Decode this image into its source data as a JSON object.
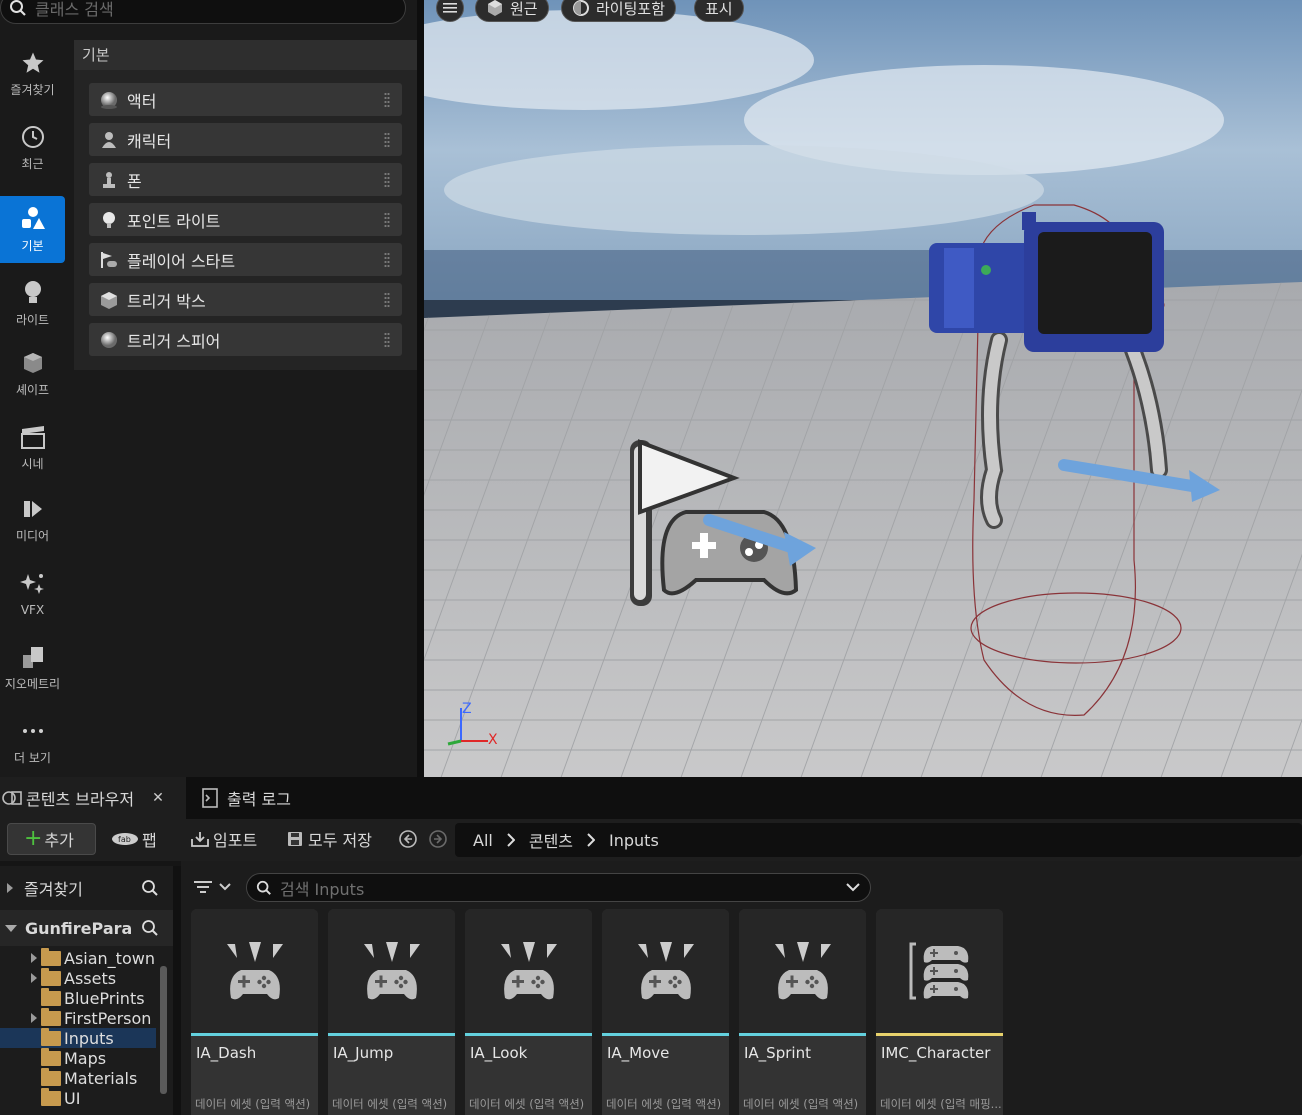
{
  "class_search": {
    "placeholder": "클래스 검색"
  },
  "categories": [
    {
      "label": "즐겨찾기",
      "icon": "star-icon"
    },
    {
      "label": "최근",
      "icon": "clock-icon"
    },
    {
      "label": "기본",
      "icon": "basic-shapes-icon",
      "active": true
    },
    {
      "label": "라이트",
      "icon": "lightbulb-icon"
    },
    {
      "label": "셰이프",
      "icon": "cube-icon"
    },
    {
      "label": "시네",
      "icon": "clapperboard-icon"
    },
    {
      "label": "미디어",
      "icon": "media-icon"
    },
    {
      "label": "VFX",
      "icon": "sparkles-icon"
    },
    {
      "label": "지오메트리",
      "icon": "geometry-icon"
    },
    {
      "label": "더 보기",
      "icon": "more-dots-icon"
    }
  ],
  "section": {
    "title": "기본"
  },
  "place_items": [
    {
      "label": "액터",
      "icon": "actor-sphere-icon"
    },
    {
      "label": "캐릭터",
      "icon": "character-icon"
    },
    {
      "label": "폰",
      "icon": "pawn-icon"
    },
    {
      "label": "포인트 라이트",
      "icon": "point-light-icon"
    },
    {
      "label": "플레이어 스타트",
      "icon": "player-start-icon"
    },
    {
      "label": "트리거 박스",
      "icon": "trigger-box-icon"
    },
    {
      "label": "트리거 스피어",
      "icon": "trigger-sphere-icon"
    }
  ],
  "viewport": {
    "menu_icon": "hamburger-icon",
    "perspective_label": "원근",
    "lighting_label": "라이팅포함",
    "show_label": "표시",
    "axis_z": "Z",
    "axis_x": "X"
  },
  "content_browser": {
    "tab_label": "콘텐츠 브라우저",
    "output_log_label": "출력 로그",
    "add_label": "추가",
    "fab_label": "팹",
    "import_label": "임포트",
    "save_all_label": "모두 저장",
    "breadcrumb": [
      "All",
      "콘텐츠",
      "Inputs"
    ],
    "favorites_label": "즐겨찾기",
    "project_label": "GunfireParagon",
    "search_placeholder": "검색 Inputs",
    "folders": [
      {
        "name": "Asian_town",
        "expandable": true
      },
      {
        "name": "Assets",
        "expandable": true
      },
      {
        "name": "BluePrints",
        "expandable": false
      },
      {
        "name": "FirstPerson",
        "expandable": true
      },
      {
        "name": "Inputs",
        "expandable": false,
        "selected": true
      },
      {
        "name": "Maps",
        "expandable": false
      },
      {
        "name": "Materials",
        "expandable": false
      },
      {
        "name": "UI",
        "expandable": false
      }
    ],
    "assets": [
      {
        "name": "IA_Dash",
        "type": "데이터 에셋 (입력 액션)"
      },
      {
        "name": "IA_Jump",
        "type": "데이터 에셋 (입력 액션)"
      },
      {
        "name": "IA_Look",
        "type": "데이터 에셋 (입력 액션)"
      },
      {
        "name": "IA_Move",
        "type": "데이터 에셋 (입력 액션)"
      },
      {
        "name": "IA_Sprint",
        "type": "데이터 에셋 (입력 액션)"
      },
      {
        "name": "IMC_Character",
        "type": "데이터 에셋 (입력 매핑..."
      }
    ]
  }
}
